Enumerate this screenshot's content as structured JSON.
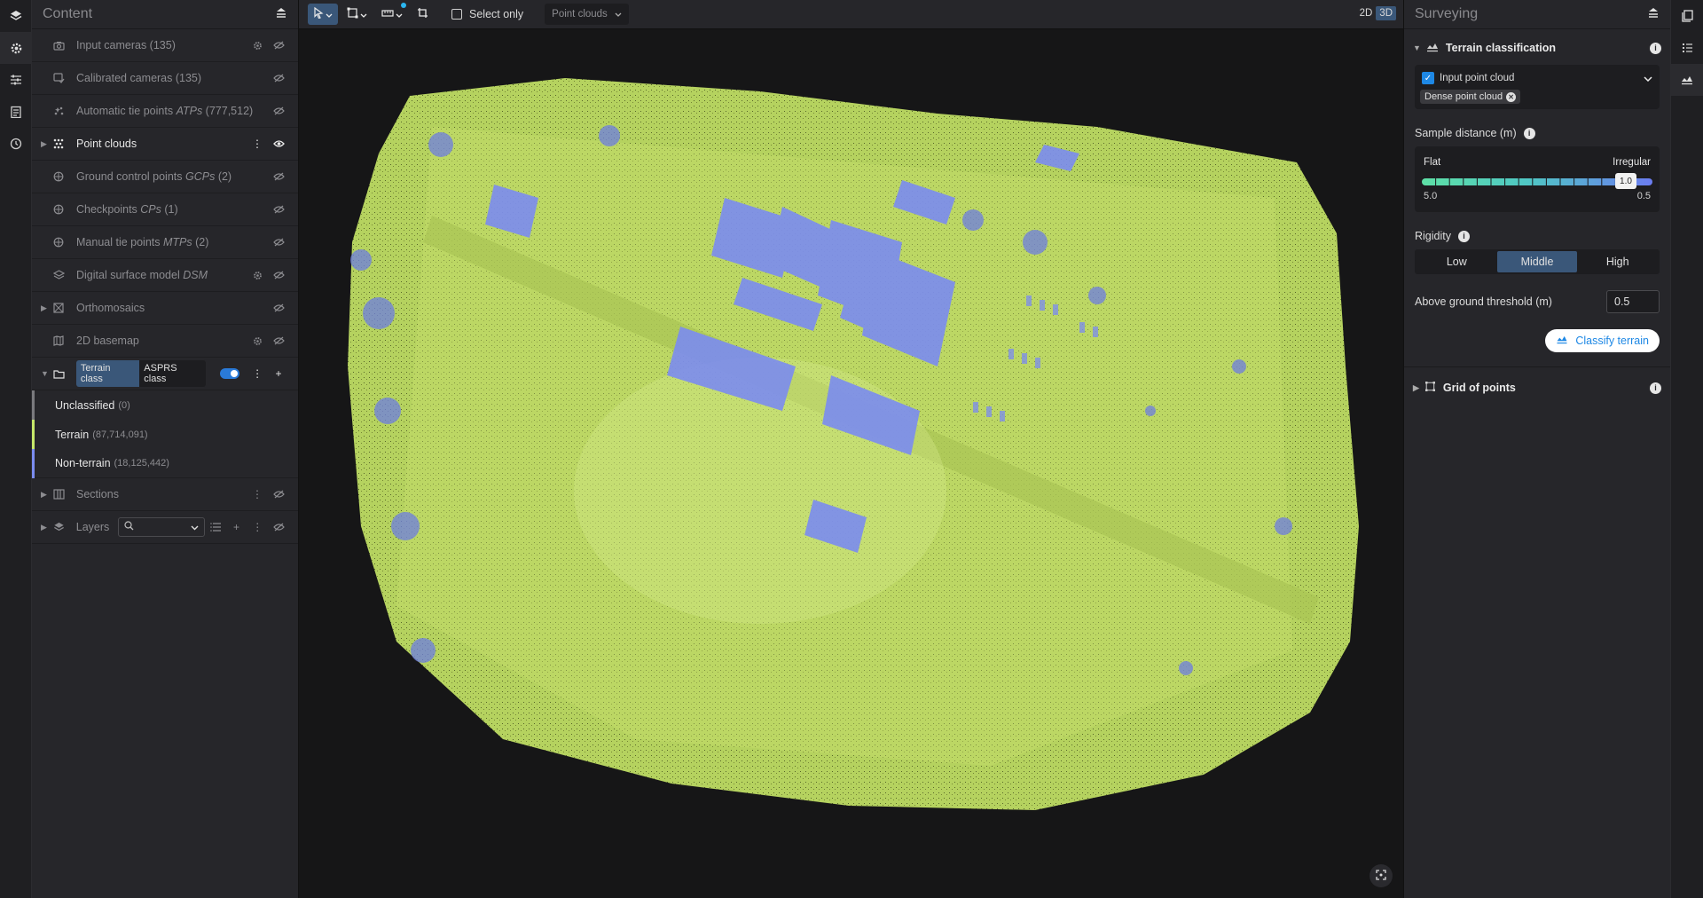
{
  "left_rail": {
    "icons": [
      "layers-icon",
      "settings-icon",
      "sliders-icon",
      "report-icon",
      "history-icon"
    ]
  },
  "content": {
    "title": "Content",
    "rows": [
      {
        "label": "Input cameras (135)",
        "italic": "",
        "suffix": ""
      },
      {
        "label": "Calibrated cameras (135)",
        "italic": "",
        "suffix": ""
      },
      {
        "label": "Automatic tie points ",
        "italic": "ATPs",
        "suffix": " (777,512)"
      },
      {
        "label": "Point clouds",
        "italic": "",
        "suffix": ""
      },
      {
        "label": "Ground control points ",
        "italic": "GCPs",
        "suffix": " (2)"
      },
      {
        "label": "Checkpoints ",
        "italic": "CPs",
        "suffix": " (1)"
      },
      {
        "label": "Manual tie points ",
        "italic": "MTPs",
        "suffix": " (2)"
      },
      {
        "label": "Digital surface model ",
        "italic": "DSM",
        "suffix": ""
      },
      {
        "label": "Orthomosaics",
        "italic": "",
        "suffix": ""
      },
      {
        "label": "2D basemap",
        "italic": "",
        "suffix": ""
      }
    ],
    "class_tabs": [
      "Terrain class",
      "ASPRS class"
    ],
    "classes": [
      {
        "name": "Unclassified",
        "count": "(0)",
        "color": "#7a7a7e"
      },
      {
        "name": "Terrain",
        "count": "(87,714,091)",
        "color": "#c6e86a"
      },
      {
        "name": "Non-terrain",
        "count": "(18,125,442)",
        "color": "#7b8cf0"
      }
    ],
    "sections_label": "Sections",
    "layers_label": "Layers"
  },
  "toolbar": {
    "select_only_label": "Select only",
    "pointcloud_select": "Point clouds",
    "view_2d": "2D",
    "view_3d": "3D"
  },
  "surveying": {
    "title": "Surveying",
    "terrain_title": "Terrain classification",
    "input_label": "Input point cloud",
    "input_chip": "Dense point cloud",
    "sample_label": "Sample distance (m)",
    "flat": "Flat",
    "irregular": "Irregular",
    "min_val": "5.0",
    "max_val": "0.5",
    "slider_val": "1.0",
    "rigidity_label": "Rigidity",
    "rigidity_options": [
      "Low",
      "Middle",
      "High"
    ],
    "threshold_label": "Above ground threshold (m)",
    "threshold_value": "0.5",
    "classify_label": "Classify terrain",
    "grid_title": "Grid of points"
  },
  "colors": {
    "accent": "#3a5779",
    "terrain": "#c6e86a",
    "nonterrain": "#7b8cf0",
    "blue": "#1e88e5"
  }
}
